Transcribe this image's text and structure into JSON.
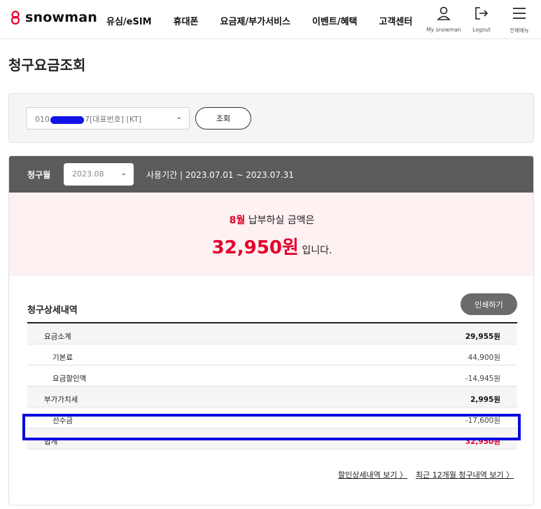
{
  "header": {
    "logo_text": "snowman",
    "nav": [
      "유심/eSIM",
      "휴대폰",
      "요금제/부가서비스",
      "이벤트/혜택",
      "고객센터"
    ],
    "util": {
      "my": "My snowman",
      "logout": "Logout",
      "menu": "전체메뉴"
    }
  },
  "page": {
    "title": "청구요금조회"
  },
  "search": {
    "line_prefix": "010",
    "line_suffix": "7[대표번호] [KT]",
    "button": "조회"
  },
  "bill": {
    "month_label": "청구월",
    "month_value": "2023.08",
    "period": "사용기간 | 2023.07.01 ~ 2023.07.31",
    "month_highlight": "8월",
    "notice_text": "납부하실 금액은",
    "amount": "32,950원",
    "amount_suffix": "입니다."
  },
  "detail": {
    "title": "청구상세내역",
    "print_button": "인쇄하기",
    "rows": [
      {
        "label": "요금소계",
        "value": "29,955원"
      },
      {
        "label": "기본료",
        "value": "44,900원"
      },
      {
        "label": "요금할인액",
        "value": "-14,945원"
      },
      {
        "label": "부가가치세",
        "value": "2,995원"
      },
      {
        "label": "선수금",
        "value": "-17,600원"
      },
      {
        "label": "합계",
        "value": "32,950원"
      }
    ]
  },
  "links": {
    "discount_detail": "할인상세내역 보기 〉",
    "recent_12": "최근 12개월 청구내역 보기 〉"
  },
  "colors": {
    "accent_red": "#e4002b",
    "bar_gray": "#5b5b5b",
    "highlight_blue": "#0a0ae0"
  }
}
